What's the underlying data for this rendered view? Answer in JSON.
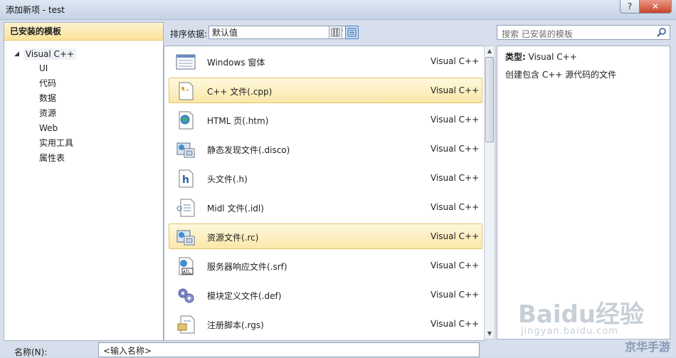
{
  "window": {
    "title": "添加新项 - test",
    "help_label": "?",
    "close_label": "✕"
  },
  "left": {
    "header": "已安装的模板",
    "root": "Visual C++",
    "children": [
      "UI",
      "代码",
      "数据",
      "资源",
      "Web",
      "实用工具",
      "属性表"
    ]
  },
  "toolbar": {
    "sort_label": "排序依据:",
    "sort_value": "默认值"
  },
  "templates": [
    {
      "name": "Windows 窗体",
      "lang": "Visual C++",
      "icon": "form-icon",
      "selected": false
    },
    {
      "name": "C++ 文件(.cpp)",
      "lang": "Visual C++",
      "icon": "cpp-file-icon",
      "selected": true
    },
    {
      "name": "HTML 页(.htm)",
      "lang": "Visual C++",
      "icon": "html-page-icon",
      "selected": false
    },
    {
      "name": "静态发现文件(.disco)",
      "lang": "Visual C++",
      "icon": "disco-file-icon",
      "selected": false
    },
    {
      "name": "头文件(.h)",
      "lang": "Visual C++",
      "icon": "header-file-icon",
      "selected": false
    },
    {
      "name": "Midl 文件(.idl)",
      "lang": "Visual C++",
      "icon": "idl-file-icon",
      "selected": false
    },
    {
      "name": "资源文件(.rc)",
      "lang": "Visual C++",
      "icon": "resource-file-icon",
      "selected": true
    },
    {
      "name": "服务器响应文件(.srf)",
      "lang": "Visual C++",
      "icon": "srf-file-icon",
      "selected": false
    },
    {
      "name": "模块定义文件(.def)",
      "lang": "Visual C++",
      "icon": "def-file-icon",
      "selected": false
    },
    {
      "name": "注册脚本(.rgs)",
      "lang": "Visual C++",
      "icon": "rgs-file-icon",
      "selected": false
    }
  ],
  "search": {
    "placeholder": "搜索 已安装的模板"
  },
  "details": {
    "type_label": "类型:",
    "type_value": "Visual C++",
    "description": "创建包含 C++ 源代码的文件"
  },
  "bottom": {
    "name_label": "名称(N):",
    "name_value": "<输入名称>"
  },
  "watermark": {
    "logo": "Baidu经验",
    "url": "jingyan.baidu.com",
    "corner": "京华手游"
  },
  "colors": {
    "selection": "#fbe7a8",
    "header": "#fbe39c",
    "chrome": "#d6dfeb"
  }
}
